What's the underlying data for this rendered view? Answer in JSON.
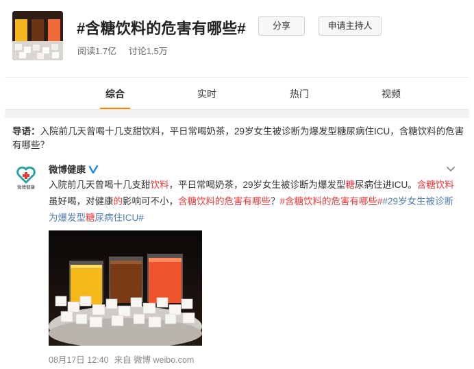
{
  "topic": {
    "title": "#含糖饮料的危害有哪些#",
    "share_label": "分享",
    "host_label": "申请主持人",
    "reads": "阅读1.7亿",
    "discussions": "讨论1.5万"
  },
  "tabs": [
    {
      "label": "综合",
      "active": true
    },
    {
      "label": "实时",
      "active": false
    },
    {
      "label": "热门",
      "active": false
    },
    {
      "label": "视频",
      "active": false
    }
  ],
  "intro": {
    "label": "导语：",
    "text": "入院前几天曾喝十几支甜饮料，平日常喝奶茶，29岁女生被诊断为爆发型糖尿病住ICU，含糖饮料的危害有哪些？"
  },
  "post": {
    "author": "微博健康",
    "avatar_caption": "微博健康",
    "body_segments": [
      {
        "text": "入院前几天曾喝十几支甜",
        "style": "normal"
      },
      {
        "text": "饮料",
        "style": "hl"
      },
      {
        "text": "，平日常喝奶茶，29岁女生被诊断为爆发型",
        "style": "normal"
      },
      {
        "text": "糖",
        "style": "hl"
      },
      {
        "text": "尿病住进ICU。",
        "style": "normal"
      },
      {
        "text": "含糖饮料",
        "style": "hl"
      },
      {
        "text": "虽好喝，对健康",
        "style": "normal"
      },
      {
        "text": "的",
        "style": "hl"
      },
      {
        "text": "影响可不小，",
        "style": "normal"
      },
      {
        "text": "含糖饮料的危害有哪些",
        "style": "hl"
      },
      {
        "text": "？",
        "style": "normal"
      },
      {
        "text": "#含糖饮料的危害有哪些#",
        "style": "hl"
      },
      {
        "text": "#29岁女生被诊断为爆发型",
        "style": "tag"
      },
      {
        "text": "糖",
        "style": "hl"
      },
      {
        "text": "尿病住ICU#",
        "style": "tag"
      }
    ],
    "date": "08月17日 12:40",
    "source": "来自 微博 weibo.com"
  },
  "colors": {
    "accent": "#ff8200",
    "highlight": "#e4393c",
    "link": "#507daf"
  }
}
